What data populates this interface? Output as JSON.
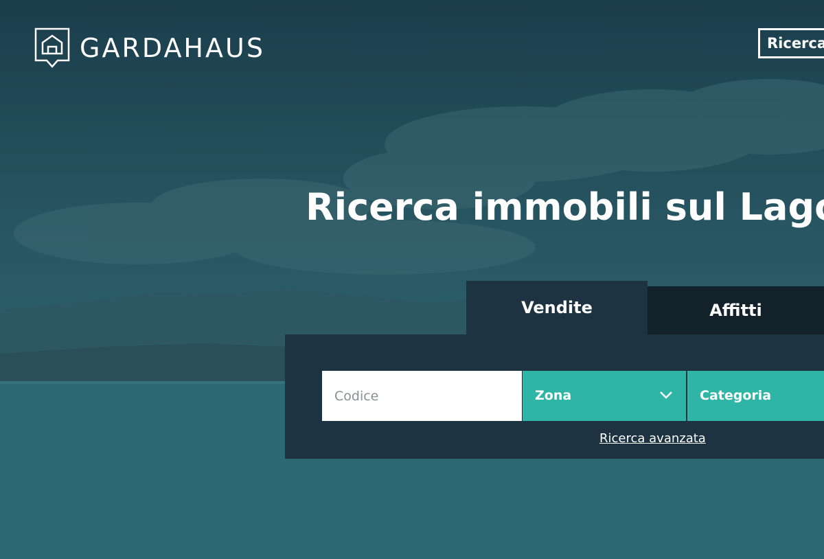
{
  "brand": {
    "name": "GARDAHAUS",
    "logo_icon": "house-pin-icon"
  },
  "header": {
    "search_button_label": "Ricerca"
  },
  "hero": {
    "title": "Ricerca immobili sul Lago"
  },
  "tabs": [
    {
      "label": "Vendite",
      "active": true
    },
    {
      "label": "Affitti",
      "active": false
    }
  ],
  "search": {
    "code_placeholder": "Codice",
    "zone_label": "Zona",
    "category_label": "Categoria",
    "advanced_link": "Ricerca avanzata",
    "dropdown_icon": "chevron-down-icon"
  },
  "colors": {
    "accent": "#2fb5a6",
    "panel": "#1e3342",
    "inactive_tab": "#13212b",
    "text": "#ffffff"
  }
}
